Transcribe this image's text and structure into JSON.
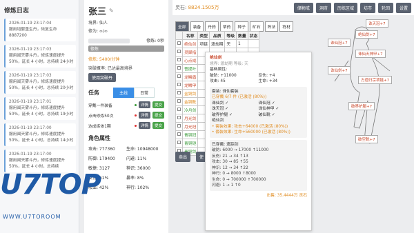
{
  "log": {
    "title": "修炼日志",
    "entries": [
      {
        "time": "2026-01-19 23:17:04",
        "text": "服用培婴重生丹，恢复生命 8887200"
      },
      {
        "time": "2026-01-19 23:17:03",
        "text": "服用闻天雾斗丹，修炼速度提升50%，延长 4 小时，总持续 24小时"
      },
      {
        "time": "2026-01-19 23:17:03",
        "text": "服用闻天雾斗丹，修炼速度提升50%，延长 4 小时，总持续 20小时"
      },
      {
        "time": "2026-01-19 23:17:01",
        "text": "服用闻天雾斗丹，修炼速度提升50%，延长 4 小时，总持续 19小时"
      },
      {
        "time": "2026-01-19 23:17:00",
        "text": "服用闻天雾斗丹，修炼速度提升50%，延长 4 小时，总持续 14小时"
      },
      {
        "time": "2026-01-19 23:17:00",
        "text": "服用闻天雾斗丹，修炼速度提升50%，延长 4 小时，总持续"
      }
    ]
  },
  "character": {
    "name": "张三",
    "realm_label": "境界: 仙人",
    "exp_label": "修为: ∞/∞",
    "cultivate_label": "修炼: 0秒",
    "speed": "修炼: 5400/分钟",
    "breakthrough": "突破概率: 已达最高境界",
    "use_pill_btn": "使用突破丹",
    "tasks_title": "任务",
    "tab_main": "主线",
    "tab_daily": "日常",
    "tasks": [
      {
        "text": "穿戴一件装备",
        "dot": "#3a9a3a",
        "b1": "详情",
        "b2": "提交"
      },
      {
        "text": "点击修炼50次",
        "dot": "#d33",
        "b1": "详情",
        "b2": "提交"
      },
      {
        "text": "达成练体1期",
        "dot": "#d33",
        "b1": "详情",
        "b2": "提交"
      }
    ],
    "stats_title": "角色属性",
    "stats": [
      "攻击: 777360",
      "生命: 10948000",
      "防御: 179400",
      "闪避: 11%",
      "敏捷: 3127",
      "神识: 36000",
      "反伤: 61%",
      "暴率: 8%",
      "吸血: 42%",
      "神行: 102%"
    ]
  },
  "topbar": {
    "spirit_label": "灵石:",
    "spirit_value": "8824.1505万",
    "buttons": [
      "储物戒",
      "洞府",
      "历练区域",
      "坊市",
      "轮回",
      "设置"
    ]
  },
  "bag": {
    "tabs": [
      "全部",
      "装备",
      "丹药",
      "草药",
      "种子",
      "矿石",
      "阵法",
      "符材"
    ],
    "headers": [
      "",
      "名称",
      "类型",
      "品质",
      "等级",
      "数量",
      "状态"
    ],
    "rows": [
      {
        "name": "绝仙剑",
        "type": "项链",
        "quality": "渡劫期",
        "level": "天",
        "qty": "1",
        "color": "#c94a2e"
      },
      {
        "name": "灵犀指",
        "type": "",
        "quality": "",
        "level": "",
        "qty": "",
        "color": "#c94a2e"
      },
      {
        "name": "心点成",
        "type": "",
        "quality": "",
        "level": "",
        "qty": "",
        "color": "#c94a2e"
      },
      {
        "name": "菩提叶",
        "type": "",
        "quality": "",
        "level": "",
        "qty": "",
        "color": "#3a9a3a"
      },
      {
        "name": "龙鳞盾",
        "type": "",
        "quality": "",
        "level": "",
        "qty": "",
        "color": "#c94a2e"
      },
      {
        "name": "龙鳞甲",
        "type": "",
        "quality": "",
        "level": "",
        "qty": "",
        "color": "#c94a2e"
      },
      {
        "name": "金铜剑",
        "type": "",
        "quality": "",
        "level": "",
        "qty": "",
        "color": "#e08a1c"
      },
      {
        "name": "金铜靴",
        "type": "",
        "quality": "",
        "level": "",
        "qty": "",
        "color": "#e08a1c"
      },
      {
        "name": "冷月剑",
        "type": "",
        "quality": "",
        "level": "",
        "qty": "",
        "color": "#3a9a3a"
      },
      {
        "name": "月光剑",
        "type": "",
        "quality": "",
        "level": "",
        "qty": "",
        "color": "#c94a2e"
      },
      {
        "name": "月光冠",
        "type": "",
        "quality": "",
        "level": "",
        "qty": "",
        "color": "#c94a2e"
      },
      {
        "name": "青铜冠",
        "type": "",
        "quality": "",
        "level": "",
        "qty": "",
        "color": "#3a9a3a"
      },
      {
        "name": "青铜铠",
        "type": "",
        "quality": "",
        "level": "",
        "qty": "",
        "color": "#3a9a3a"
      },
      {
        "name": "青铜剑",
        "type": "",
        "quality": "",
        "level": "",
        "qty": "",
        "color": "#3a9a3a"
      }
    ],
    "sell": "卖出",
    "sell2": "使"
  },
  "tooltip": {
    "name": "绝仙剑",
    "sub": "境界: 渡劫期  等级: 天",
    "attrs_title": "基础属性:",
    "attrs": [
      "破防: +11000",
      "反伤: +4",
      "攻击: 45",
      "生命: +34"
    ],
    "set_title": "套装: 诛仙套装",
    "set_status": "已穿戴 6/7 件 (已激活 (80%))",
    "set_items": [
      "诛仙剑 ✓",
      "诛仙冠 ✓",
      "诛天冠 ✓",
      "诛仙神甲 ✓",
      "破界护腿 ✓",
      "破仙靴 ✓",
      "绝仙剑"
    ],
    "effect1": "• 套装效果: 攻击+64000 (已激活 (80%))",
    "effect2": "• 套装效果: 生命+560000 (已激活 (80%))",
    "compare_title": "已穿戴: 遗踪剑",
    "compare": [
      "破防: 6000 → 17000 ↑11000",
      "反伤: 21 → 34 ↑13",
      "攻击: 30 → 85 ↑55",
      "神识: 12 → 34 ↑22",
      "神行: 0 → 8000 ↑8000",
      "生命: 0 → 700000 ↑700000",
      "闪避: 1 → 1 ↑0"
    ],
    "price": "出售: 35.4444万 灵石"
  },
  "equip_slots": [
    "诛天冠+7",
    "绝仙剑+7",
    "诛仙冠+7",
    "诛仙天神甲+7",
    "诛仙剑+7",
    "方道归宗项链+7",
    "破界护腿+7",
    "破空靴+7"
  ],
  "watermark": {
    "main": "U7TOP",
    "sub": "WWW.U7TOROOM"
  }
}
